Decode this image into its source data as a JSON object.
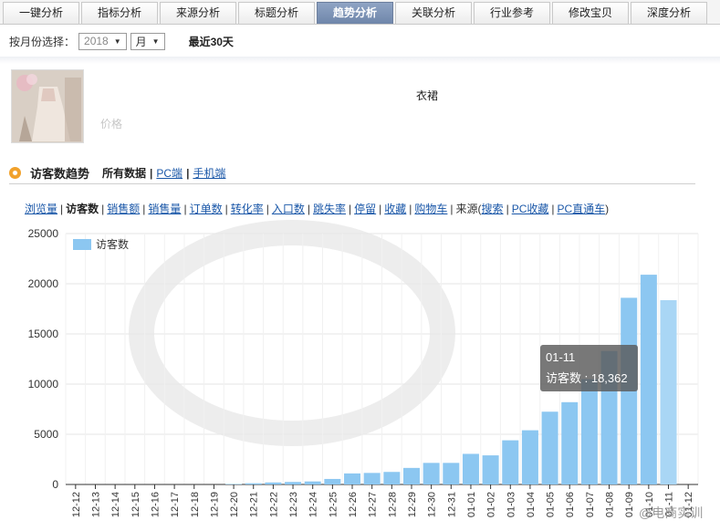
{
  "tabs": [
    {
      "label": "一键分析"
    },
    {
      "label": "指标分析"
    },
    {
      "label": "来源分析"
    },
    {
      "label": "标题分析"
    },
    {
      "label": "趋势分析",
      "active": true
    },
    {
      "label": "关联分析"
    },
    {
      "label": "行业参考"
    },
    {
      "label": "修改宝贝"
    },
    {
      "label": "深度分析"
    }
  ],
  "filter": {
    "label": "按月份选择：",
    "year": "2018",
    "period": "月",
    "recent": "最近30天"
  },
  "product": {
    "title": "衣裙",
    "price": "价格"
  },
  "section": {
    "title": "访客数趋势",
    "all": "所有数据",
    "pc": "PC端",
    "mobile": "手机端"
  },
  "metrics": {
    "items": [
      "浏览量",
      "访客数",
      "销售额",
      "销售量",
      "订单数",
      "转化率",
      "入口数",
      "跳失率",
      "停留",
      "收藏",
      "购物车"
    ],
    "active": "访客数",
    "source_label": "来源(",
    "sources": [
      "搜索",
      "PC收藏",
      "PC直通车"
    ],
    "source_close": ")"
  },
  "tooltip": {
    "date": "01-11",
    "label": "访客数 : 18,362"
  },
  "watermark": "@电商实训",
  "colors": {
    "bar": "#8cc7f1",
    "bar_highlight": "#a9d6f5",
    "grid": "#e6e6e6",
    "tab_active": "#7489ab",
    "link": "#1a57a8",
    "accent": "#f1a12a"
  },
  "chart_data": {
    "type": "bar",
    "legend": "访客数",
    "categories": [
      "12-12",
      "12-13",
      "12-14",
      "12-15",
      "12-16",
      "12-17",
      "12-18",
      "12-19",
      "12-20",
      "12-21",
      "12-22",
      "12-23",
      "12-24",
      "12-25",
      "12-26",
      "12-27",
      "12-28",
      "12-29",
      "12-30",
      "12-31",
      "01-01",
      "01-02",
      "01-03",
      "01-04",
      "01-05",
      "01-06",
      "01-07",
      "01-08",
      "01-09",
      "01-10",
      "01-11",
      "01-12"
    ],
    "values": [
      0,
      0,
      0,
      0,
      0,
      0,
      0,
      0,
      50,
      120,
      200,
      250,
      300,
      550,
      1100,
      1150,
      1250,
      1650,
      2150,
      2150,
      3050,
      2900,
      4400,
      5400,
      7250,
      8200,
      10500,
      13300,
      18600,
      20900,
      18362,
      0
    ],
    "highlight_index": 30,
    "ylim": [
      0,
      25000
    ],
    "yticks": [
      0,
      5000,
      10000,
      15000,
      20000,
      25000
    ],
    "legend_position": "top-left",
    "grid": true
  }
}
